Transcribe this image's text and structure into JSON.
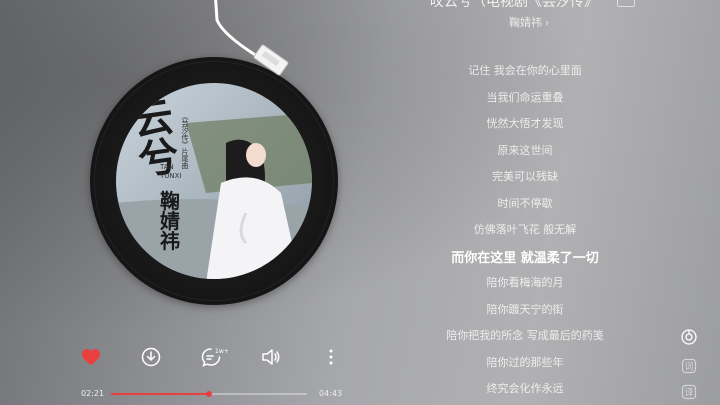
{
  "header": {
    "song_title": "叹云兮（电视剧《芸汐传》",
    "quality_badge": "",
    "artist": "鞠婧祎",
    "artist_chevron": "›"
  },
  "album_cover": {
    "title_chars": "云兮",
    "subtitle": "《芸汐传》片尾曲",
    "en_line1": "TAN",
    "en_line2": "YUNXI",
    "artist_chars": "鞠婧祎"
  },
  "lyrics": [
    {
      "text": "记住 我会在你的心里面"
    },
    {
      "text": "当我们命运重叠"
    },
    {
      "text": "恍然大悟才发现"
    },
    {
      "text": "原来这世间"
    },
    {
      "text": "完美可以残缺"
    },
    {
      "text": "时间不停歇"
    },
    {
      "text": "仿佛落叶飞花 般无解"
    },
    {
      "text": "而你在这里 就温柔了一切",
      "active": true
    },
    {
      "text": "陪你看梅海的月"
    },
    {
      "text": "陪你踱天宁的街"
    },
    {
      "text": "陪你把我的所念 写成最后的药笺"
    },
    {
      "text": "陪你过的那些年"
    },
    {
      "text": "终究会化作永远"
    }
  ],
  "controls": {
    "like": "heart-icon",
    "download": "download-icon",
    "comment": "comment-icon",
    "comment_count": "1w+",
    "sound": "sound-icon",
    "more": "more-icon"
  },
  "progress": {
    "current": "02:21",
    "total": "04:43",
    "fraction": 0.5
  },
  "colors": {
    "accent": "#e8403e"
  }
}
